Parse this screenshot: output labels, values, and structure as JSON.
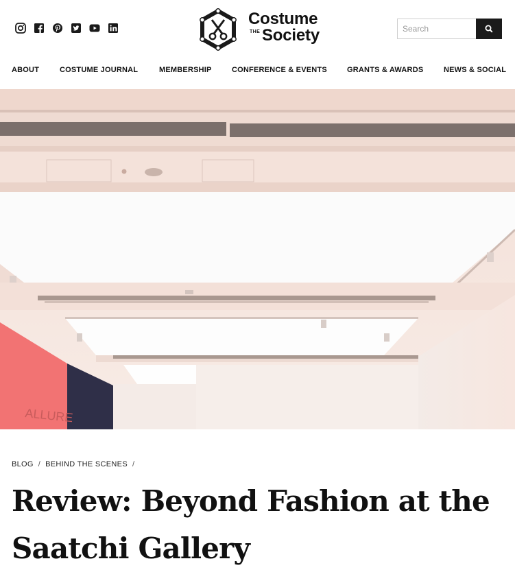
{
  "social": [
    {
      "name": "instagram-icon"
    },
    {
      "name": "facebook-icon"
    },
    {
      "name": "pinterest-icon"
    },
    {
      "name": "twitter-icon"
    },
    {
      "name": "youtube-icon"
    },
    {
      "name": "linkedin-icon"
    }
  ],
  "logo": {
    "line1": "Costume",
    "the": "THE",
    "line2": "Society"
  },
  "search": {
    "placeholder": "Search",
    "icon": "search-icon"
  },
  "nav": {
    "items": [
      {
        "label": "ABOUT"
      },
      {
        "label": "COSTUME JOURNAL"
      },
      {
        "label": "MEMBERSHIP"
      },
      {
        "label": "CONFERENCE & EVENTS"
      },
      {
        "label": "GRANTS & AWARDS"
      },
      {
        "label": "NEWS & SOCIAL"
      }
    ]
  },
  "hero": {
    "wall_text": "ALLURE"
  },
  "breadcrumb": {
    "items": [
      {
        "label": "BLOG"
      },
      {
        "label": "BEHIND THE SCENES"
      }
    ],
    "separator": "/"
  },
  "article": {
    "title": "Review: Beyond Fashion at the Saatchi Gallery"
  },
  "colors": {
    "dark": "#1a1a1a",
    "accent_wall": "#f26a6a",
    "navy_wall": "#2f2f48"
  }
}
